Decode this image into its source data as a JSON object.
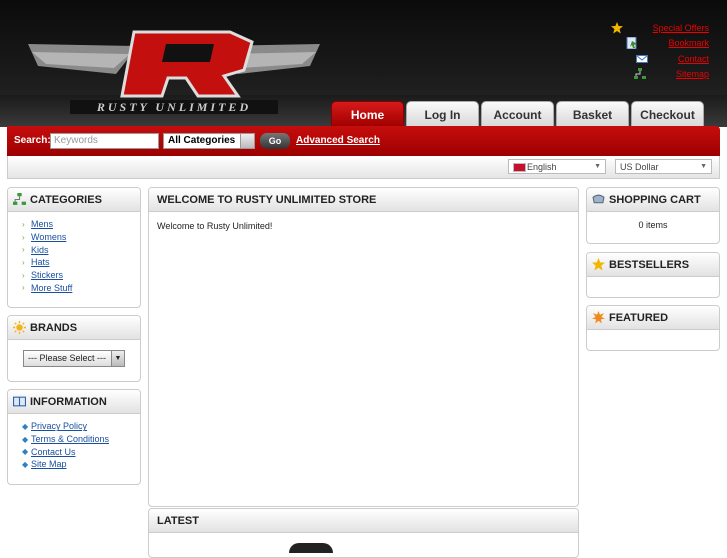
{
  "brand": {
    "logo_letter": "R",
    "logo_text": "RUSTY UNLIMITED"
  },
  "top_links": [
    {
      "label": "Special Offers",
      "icon": "star-icon"
    },
    {
      "label": "Bookmark",
      "icon": "bookmark-icon"
    },
    {
      "label": "Contact",
      "icon": "envelope-icon"
    },
    {
      "label": "Sitemap",
      "icon": "sitemap-icon"
    }
  ],
  "tabs": [
    "Home",
    "Log In",
    "Account",
    "Basket",
    "Checkout"
  ],
  "search": {
    "label": "Search:",
    "placeholder": "Keywords",
    "category": "All Categories",
    "button": "Go",
    "advanced": "Advanced Search"
  },
  "language": "English",
  "currency": "US Dollar",
  "categories": {
    "title": "CATEGORIES",
    "items": [
      "Mens",
      "Womens",
      "Kids",
      "Hats",
      "Stickers",
      "More Stuff"
    ]
  },
  "brands": {
    "title": "BRANDS",
    "select": "--- Please Select ---"
  },
  "information": {
    "title": "INFORMATION",
    "items": [
      "Privacy Policy",
      "Terms & Conditions",
      "Contact Us",
      "Site Map"
    ]
  },
  "welcome": {
    "title": "WELCOME TO RUSTY UNLIMITED STORE",
    "body": "Welcome to Rusty Unlimited!"
  },
  "latest": {
    "title": "LATEST"
  },
  "cart": {
    "title": "SHOPPING CART",
    "status": "0 items"
  },
  "bestsellers": {
    "title": "BESTSELLERS"
  },
  "featured": {
    "title": "FEATURED"
  },
  "colors": {
    "brand_red": "#c70d0d",
    "link_blue": "#1a4fa0",
    "header_black": "#111111"
  }
}
